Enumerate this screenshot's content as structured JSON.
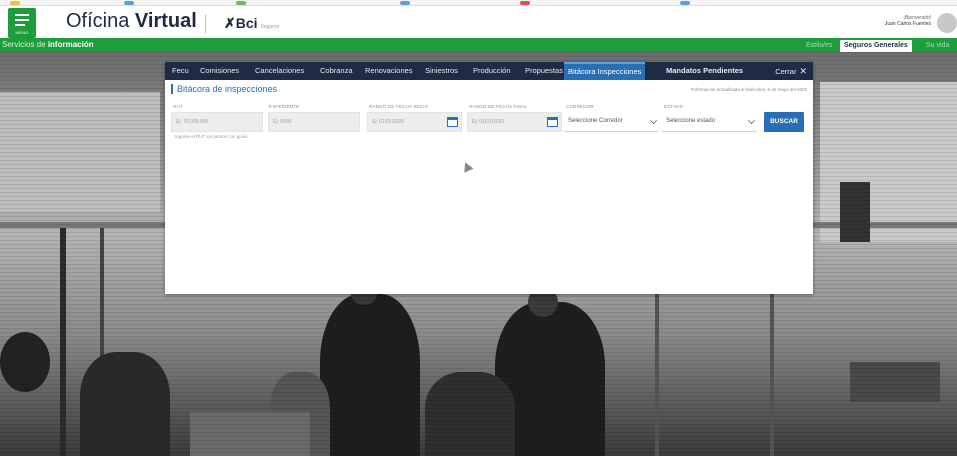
{
  "header": {
    "app_title_prefix": "Ofícina",
    "app_title_bold": "Virtual",
    "menu_label": "MENÚ",
    "logo_x": "✗",
    "logo_text": "Bci",
    "logo_sub": "Seguros",
    "welcome": "¡Bienvenido!",
    "user_name": "Juan Carlos Fuentes"
  },
  "services_bar": {
    "title_prefix": "Servicios de",
    "title_bold": "información",
    "tabs": [
      {
        "label": "Estilo/es",
        "active": false
      },
      {
        "label": "Seguros Generales",
        "active": true
      },
      {
        "label": "Su vida",
        "active": false
      }
    ]
  },
  "panel": {
    "tabs": [
      {
        "label": "Fecu"
      },
      {
        "label": "Comisiones"
      },
      {
        "label": "Cancelaciones"
      },
      {
        "label": "Cobranza"
      },
      {
        "label": "Renovaciones"
      },
      {
        "label": "Siniestros"
      },
      {
        "label": "Producción"
      },
      {
        "label": "Propuestas"
      },
      {
        "label": "Bitácora Inspecciones"
      },
      {
        "label": "Mandatos Pendientes"
      }
    ],
    "close_label": "Cerrar",
    "close_icon": "✕",
    "section_title": "Bitácora de inspecciones",
    "info_note": "*Información actualizada al miércoles, 6 de mayo del 2020",
    "fields": {
      "rut": {
        "label": "RUT",
        "placeholder": "Ej: 76.000.000"
      },
      "expediente": {
        "label": "EXPEDIENTE",
        "placeholder": "Ej: 0000"
      },
      "fecha_inicio": {
        "label": "RANGO DE FECHA INICIO",
        "placeholder": "Ej: 01/01/2020"
      },
      "fecha_final": {
        "label": "RANGO DE FECHA FINAL",
        "placeholder": "Ej: 01/01/2020"
      },
      "corredor": {
        "label": "CORREDOR",
        "value": "Seleccione Corredor"
      },
      "estado": {
        "label": "ESTADO",
        "value": "Seleccione estado"
      }
    },
    "helper_text": "Ingrese el RUT sin puntos con guion",
    "search_label": "BUSCAR"
  }
}
